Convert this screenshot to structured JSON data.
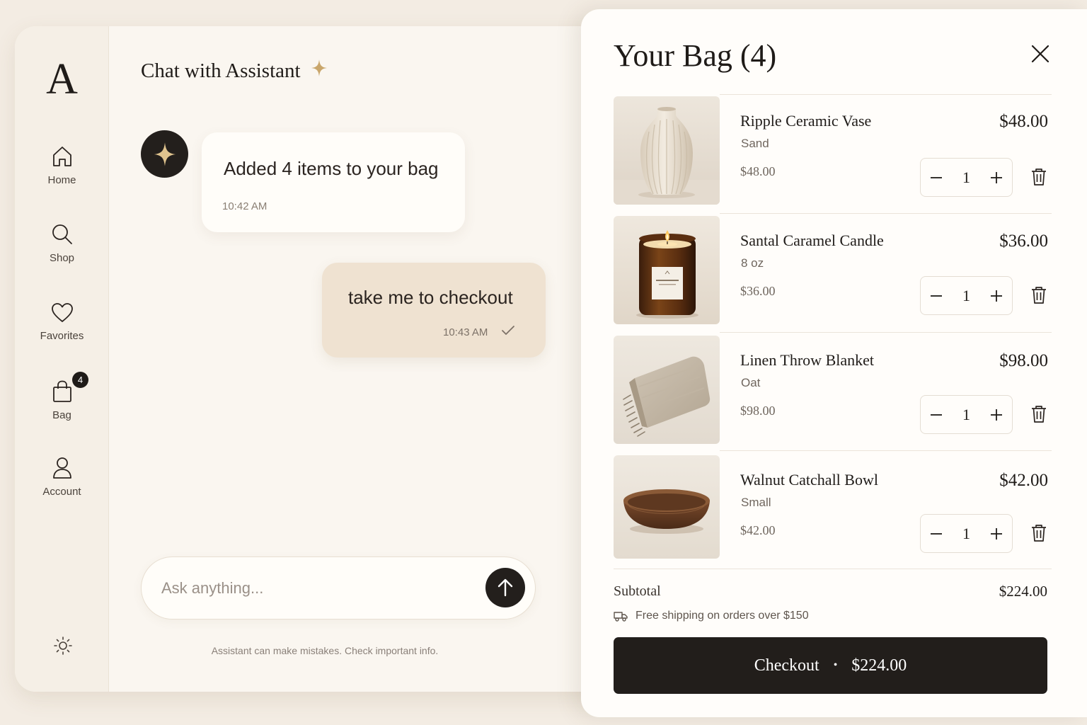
{
  "brand": {
    "logo_letter": "A"
  },
  "sidebar": {
    "items": [
      {
        "label": "Home",
        "icon": "home-icon"
      },
      {
        "label": "Shop",
        "icon": "search-icon"
      },
      {
        "label": "Favorites",
        "icon": "heart-icon"
      },
      {
        "label": "Bag",
        "icon": "bag-icon",
        "badge": "4"
      },
      {
        "label": "Account",
        "icon": "user-icon"
      }
    ],
    "theme_toggle_icon": "sun-icon"
  },
  "chat": {
    "title": "Chat with Assistant",
    "messages": [
      {
        "from": "assistant",
        "text": "Added 4 items to your bag",
        "time": "10:42 AM"
      },
      {
        "from": "user",
        "text": "take me to checkout",
        "time": "10:43 AM",
        "status": "read"
      }
    ],
    "input": {
      "placeholder": "Ask anything...",
      "value": ""
    },
    "disclaimer": "Assistant can make mistakes. Check important info."
  },
  "bag": {
    "title": "Your Bag (4)",
    "items": [
      {
        "name": "Ripple Ceramic Vase",
        "variant": "Sand",
        "unit_price": "$48.00",
        "total": "$48.00",
        "qty": "1"
      },
      {
        "name": "Santal Caramel Candle",
        "variant": "8 oz",
        "unit_price": "$36.00",
        "total": "$36.00",
        "qty": "1"
      },
      {
        "name": "Linen Throw Blanket",
        "variant": "Oat",
        "unit_price": "$98.00",
        "total": "$98.00",
        "qty": "1"
      },
      {
        "name": "Walnut Catchall Bowl",
        "variant": "Small",
        "unit_price": "$42.00",
        "total": "$42.00",
        "qty": "1"
      }
    ],
    "subtotal_label": "Subtotal",
    "subtotal_value": "$224.00",
    "shipping_note": "Free shipping on orders over $150",
    "checkout_label": "Checkout",
    "checkout_separator": "•",
    "checkout_amount": "$224.00"
  },
  "colors": {
    "accent_gold": "#c9a66b",
    "dark": "#221e1b",
    "background": "#f3ece3"
  }
}
